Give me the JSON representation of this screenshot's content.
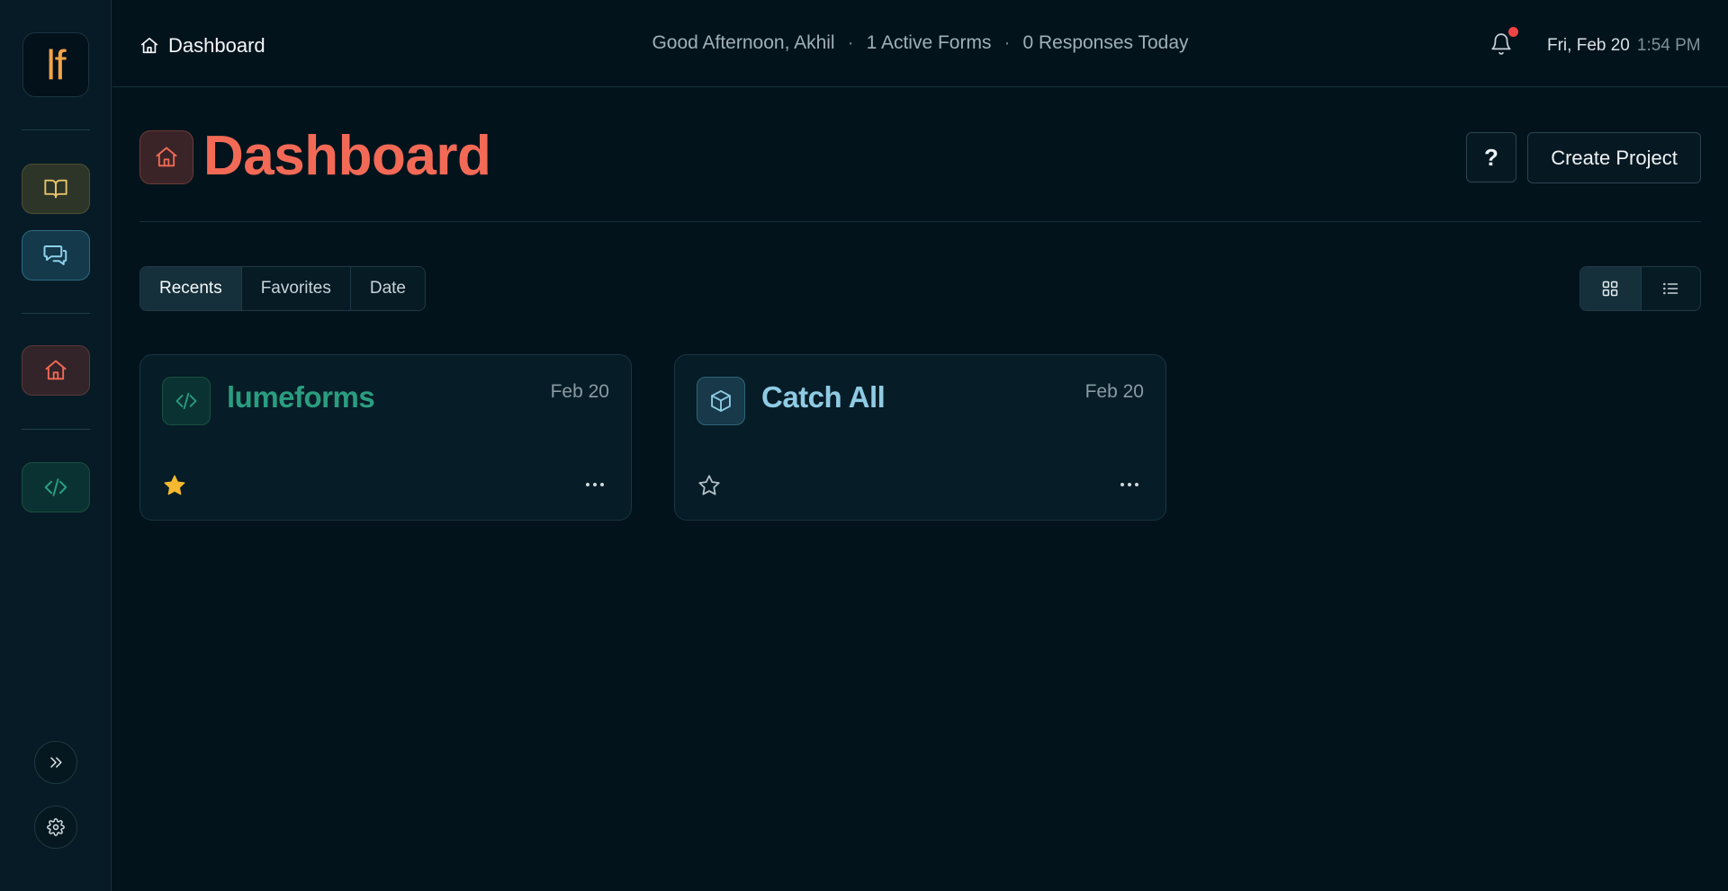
{
  "app": {
    "logo_text": "lf",
    "logo_color": "#f3a347"
  },
  "sidebar": {
    "items": [
      {
        "name": "book",
        "icon": "book-open-icon",
        "color": "#e8c36a"
      },
      {
        "name": "chat",
        "icon": "chat-bubbles-icon",
        "color": "#8fd0ea"
      },
      {
        "name": "home",
        "icon": "home-icon",
        "color": "#f26a56"
      },
      {
        "name": "code",
        "icon": "code-icon",
        "color": "#2a9d7f"
      }
    ],
    "bottom": [
      {
        "name": "expand",
        "icon": "chevrons-right-icon"
      },
      {
        "name": "settings",
        "icon": "gear-icon"
      }
    ]
  },
  "topbar": {
    "breadcrumb": "Dashboard",
    "greeting": "Good Afternoon, Akhil",
    "active_forms": "1 Active Forms",
    "responses": "0 Responses Today",
    "separator": "·",
    "date": "Fri, Feb 20",
    "time": "1:54 PM",
    "notification_badge_color": "#ef4444"
  },
  "header": {
    "title": "Dashboard",
    "title_color": "#f26a56",
    "help_label": "?",
    "create_label": "Create Project"
  },
  "tabs": [
    {
      "label": "Recents",
      "active": true
    },
    {
      "label": "Favorites",
      "active": false
    },
    {
      "label": "Date",
      "active": false
    }
  ],
  "view_toggle": {
    "selected": "grid",
    "options": [
      "grid-view-icon",
      "list-view-icon"
    ]
  },
  "projects": [
    {
      "title": "lumeforms",
      "date": "Feb 20",
      "icon": "code-icon",
      "favorite": true,
      "accent": "#2a9d7f"
    },
    {
      "title": "Catch All",
      "date": "Feb 20",
      "icon": "cube-icon",
      "favorite": false,
      "accent": "#8fcbe3"
    }
  ]
}
